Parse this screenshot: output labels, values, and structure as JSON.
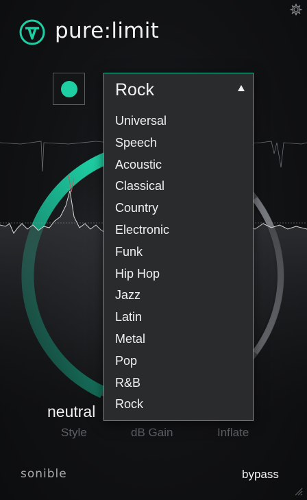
{
  "header": {
    "title": "pure:limit",
    "logo_icon": "sonible-v-logo-icon",
    "settings_icon": "gear-icon"
  },
  "power": {
    "state": "on",
    "color": "#1fcfa4"
  },
  "dropdown": {
    "selected": "Rock",
    "items": [
      "Universal",
      "Speech",
      "Acoustic",
      "Classical",
      "Country",
      "Electronic",
      "Funk",
      "Hip Hop",
      "Jazz",
      "Latin",
      "Metal",
      "Pop",
      "R&B",
      "Rock"
    ],
    "border_color": "#1fbf99"
  },
  "controls": {
    "style_value": "neutral",
    "labels": [
      "Style",
      "dB Gain",
      "Inflate"
    ]
  },
  "footer": {
    "brand": "sonible",
    "bypass_label": "bypass"
  },
  "colors": {
    "accent": "#1fcfa4",
    "background": "#0d0e10",
    "panel": "#2a2b2d"
  }
}
